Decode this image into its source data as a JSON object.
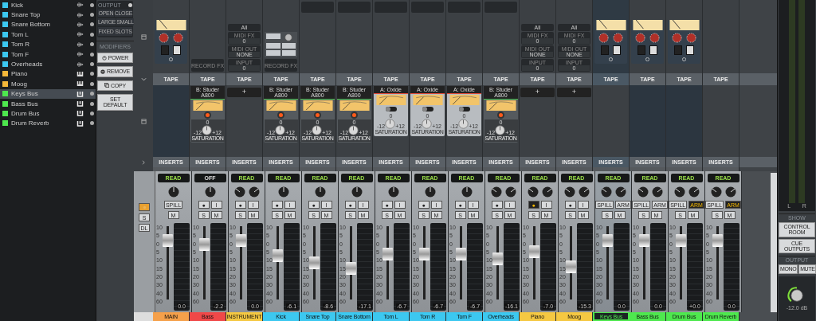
{
  "tracks": [
    {
      "name": "Kick",
      "color": "#3cc8f0",
      "kind": "audio",
      "selected": false
    },
    {
      "name": "Snare Top",
      "color": "#3cc8f0",
      "kind": "audio",
      "selected": false
    },
    {
      "name": "Snare Bottom",
      "color": "#3cc8f0",
      "kind": "audio",
      "selected": false
    },
    {
      "name": "Tom L",
      "color": "#3cc8f0",
      "kind": "audio",
      "selected": false
    },
    {
      "name": "Tom R",
      "color": "#3cc8f0",
      "kind": "audio",
      "selected": false
    },
    {
      "name": "Tom F",
      "color": "#3cc8f0",
      "kind": "audio",
      "selected": false
    },
    {
      "name": "Overheads",
      "color": "#3cc8f0",
      "kind": "audio",
      "selected": false
    },
    {
      "name": "Piano",
      "color": "#f5b83a",
      "kind": "instrument",
      "selected": false
    },
    {
      "name": "Moog",
      "color": "#f5b83a",
      "kind": "instrument",
      "selected": false
    },
    {
      "name": "Keys Bus",
      "color": "#4ee84e",
      "kind": "bus",
      "selected": true
    },
    {
      "name": "Bass Bus",
      "color": "#4ee84e",
      "kind": "bus",
      "selected": false
    },
    {
      "name": "Drum Bus",
      "color": "#4ee84e",
      "kind": "bus",
      "selected": false
    },
    {
      "name": "Drum Reverb",
      "color": "#4ee84e",
      "kind": "bus",
      "selected": false
    }
  ],
  "view_panel": {
    "output": "OUTPUT",
    "open": "OPEN",
    "close": "CLOSE",
    "large": "LARGE",
    "small": "SMALL",
    "fixed_slots": "FIXED SLOTS"
  },
  "modifiers": {
    "title": "MODIFIERS",
    "buttons": [
      "POWER",
      "REMOVE",
      "COPY",
      "SET DEFAULT"
    ]
  },
  "strip_lead": {
    "buttons": [
      "S",
      "DL"
    ]
  },
  "channels": [
    {
      "name": "MAIN",
      "color": "#f5a04a",
      "selected": false,
      "top": {
        "kind": "preamp",
        "switches": [
          {
            "on": false
          },
          {
            "on": true
          }
        ]
      },
      "tape_header": "TAPE",
      "tape": {
        "kind": "none"
      },
      "inserts_header": "INSERTS",
      "automation": {
        "label": "READ",
        "on": true
      },
      "stereo": false,
      "button_rows": [
        [
          {
            "label": "SPILL",
            "active": false
          }
        ],
        [
          {
            "label": "M",
            "active": false
          }
        ]
      ],
      "fader_scale": [
        "10",
        "5",
        "0",
        "5",
        "10",
        "15",
        "20",
        "30",
        "40",
        "60"
      ],
      "level": 0.8,
      "reading": "0.0"
    },
    {
      "name": "Bass",
      "color": "#f04848",
      "selected": false,
      "top": {
        "kind": "record",
        "label": "RECORD FX"
      },
      "tape_header": "TAPE",
      "tape": {
        "kind": "studer",
        "name": "B: Studer A800",
        "lamp_on": true,
        "marks": [
          "0",
          "-12",
          "+12"
        ],
        "label": "SATURATION"
      },
      "inserts_header": "INSERTS",
      "automation": {
        "label": "OFF",
        "on": false
      },
      "stereo": false,
      "button_rows": [
        [
          {
            "label": "●",
            "active": false
          },
          {
            "label": "I",
            "active": false
          }
        ],
        [
          {
            "label": "S",
            "active": false
          },
          {
            "label": "M",
            "active": false
          }
        ]
      ],
      "fader_scale": [
        "10",
        "5",
        "0",
        "5",
        "10",
        "15",
        "20",
        "30",
        "40",
        "60"
      ],
      "level": 0.75,
      "reading": "-2.2"
    },
    {
      "name": "INSTRUMENT",
      "color": "#f5c842",
      "selected": false,
      "top": {
        "kind": "midi",
        "fields": [
          {
            "label": "All"
          },
          {
            "caption": "MIDI FX",
            "label": "0"
          },
          {
            "caption": "MIDI OUT",
            "label": "NONE"
          },
          {
            "caption": "INPUT",
            "label": "0"
          }
        ]
      },
      "tape_header": "TAPE",
      "tape": {
        "kind": "empty",
        "name": "+"
      },
      "inserts_header": "INSERTS",
      "automation": {
        "label": "READ",
        "on": true
      },
      "stereo": true,
      "button_rows": [
        [
          {
            "label": "●",
            "active": false
          },
          {
            "label": "I",
            "active": false
          }
        ],
        [
          {
            "label": "S",
            "active": false
          },
          {
            "label": "M",
            "active": false
          }
        ]
      ],
      "fader_scale": [
        "10",
        "5",
        "0",
        "5",
        "10",
        "15",
        "20",
        "30",
        "40",
        "60"
      ],
      "level": 0.8,
      "reading": "0.0"
    },
    {
      "name": "Kick",
      "color": "#3cc8f0",
      "selected": false,
      "top": {
        "kind": "pads",
        "label": "RECORD FX"
      },
      "tape_header": "TAPE",
      "tape": {
        "kind": "studer",
        "name": "B: Studer A800",
        "lamp_on": true,
        "marks": [
          "0",
          "-12",
          "+12"
        ],
        "label": "SATURATION"
      },
      "inserts_header": "INSERTS",
      "automation": {
        "label": "READ",
        "on": true
      },
      "stereo": false,
      "button_rows": [
        [
          {
            "label": "●",
            "active": false
          },
          {
            "label": "I",
            "active": false
          }
        ],
        [
          {
            "label": "S",
            "active": false
          },
          {
            "label": "M",
            "active": false
          }
        ]
      ],
      "fader_scale": [
        "10",
        "5",
        "0",
        "5",
        "10",
        "15",
        "20",
        "30",
        "40",
        "60"
      ],
      "level": 0.6,
      "reading": "-6.1"
    },
    {
      "name": "Snare Top",
      "color": "#3cc8f0",
      "selected": false,
      "top": {
        "kind": "box"
      },
      "tape_header": "TAPE",
      "tape": {
        "kind": "studer",
        "name": "B: Studer A800",
        "lamp_on": true,
        "marks": [
          "0",
          "-12",
          "+12"
        ],
        "label": "SATURATION"
      },
      "inserts_header": "INSERTS",
      "automation": {
        "label": "READ",
        "on": true
      },
      "stereo": false,
      "button_rows": [
        [
          {
            "label": "●",
            "active": false
          },
          {
            "label": "I",
            "active": false
          }
        ],
        [
          {
            "label": "S",
            "active": false
          },
          {
            "label": "M",
            "active": false
          }
        ]
      ],
      "fader_scale": [
        "10",
        "5",
        "0",
        "5",
        "10",
        "15",
        "20",
        "30",
        "40",
        "60"
      ],
      "level": 0.5,
      "reading": "-8.6"
    },
    {
      "name": "Snare Bottom",
      "color": "#3cc8f0",
      "selected": false,
      "top": {
        "kind": "box"
      },
      "tape_header": "TAPE",
      "tape": {
        "kind": "studer",
        "name": "B: Studer A800",
        "lamp_on": true,
        "marks": [
          "0",
          "-12",
          "+12"
        ],
        "label": "SATURATION"
      },
      "inserts_header": "INSERTS",
      "automation": {
        "label": "READ",
        "on": true
      },
      "stereo": false,
      "button_rows": [
        [
          {
            "label": "●",
            "active": false
          },
          {
            "label": "I",
            "active": false
          }
        ],
        [
          {
            "label": "S",
            "active": false
          },
          {
            "label": "M",
            "active": false
          }
        ]
      ],
      "fader_scale": [
        "10",
        "5",
        "0",
        "5",
        "10",
        "15",
        "20",
        "30",
        "40",
        "60"
      ],
      "level": 0.42,
      "reading": "-17.1"
    },
    {
      "name": "Tom L",
      "color": "#3cc8f0",
      "selected": false,
      "top": {
        "kind": "box"
      },
      "tape_header": "TAPE",
      "tape": {
        "kind": "oxide",
        "name": "A: Oxide",
        "switch_on": false,
        "marks": [
          "0",
          "-12",
          "+12"
        ],
        "label": "SATURATION"
      },
      "inserts_header": "INSERTS",
      "automation": {
        "label": "READ",
        "on": true
      },
      "stereo": false,
      "button_rows": [
        [
          {
            "label": "●",
            "active": false
          },
          {
            "label": "I",
            "active": false
          }
        ],
        [
          {
            "label": "S",
            "active": false
          },
          {
            "label": "M",
            "active": false
          }
        ]
      ],
      "fader_scale": [
        "10",
        "5",
        "0",
        "5",
        "10",
        "15",
        "20",
        "30",
        "40",
        "60"
      ],
      "level": 0.62,
      "reading": "-6.7"
    },
    {
      "name": "Tom R",
      "color": "#3cc8f0",
      "selected": false,
      "top": {
        "kind": "box"
      },
      "tape_header": "TAPE",
      "tape": {
        "kind": "oxide",
        "name": "A: Oxide",
        "switch_on": false,
        "marks": [
          "0",
          "-12",
          "+12"
        ],
        "label": "SATURATION"
      },
      "inserts_header": "INSERTS",
      "automation": {
        "label": "READ",
        "on": true
      },
      "stereo": false,
      "button_rows": [
        [
          {
            "label": "●",
            "active": false
          },
          {
            "label": "I",
            "active": false
          }
        ],
        [
          {
            "label": "S",
            "active": false
          },
          {
            "label": "M",
            "active": false
          }
        ]
      ],
      "fader_scale": [
        "10",
        "5",
        "0",
        "5",
        "10",
        "15",
        "20",
        "30",
        "40",
        "60"
      ],
      "level": 0.62,
      "reading": "-6.7"
    },
    {
      "name": "Tom F",
      "color": "#3cc8f0",
      "selected": false,
      "top": {
        "kind": "box"
      },
      "tape_header": "TAPE",
      "tape": {
        "kind": "oxide",
        "name": "A: Oxide",
        "switch_on": false,
        "marks": [
          "0",
          "-12",
          "+12"
        ],
        "label": "SATURATION"
      },
      "inserts_header": "INSERTS",
      "automation": {
        "label": "READ",
        "on": true
      },
      "stereo": false,
      "button_rows": [
        [
          {
            "label": "●",
            "active": false
          },
          {
            "label": "I",
            "active": false
          }
        ],
        [
          {
            "label": "S",
            "active": false
          },
          {
            "label": "M",
            "active": false
          }
        ]
      ],
      "fader_scale": [
        "10",
        "5",
        "0",
        "5",
        "10",
        "15",
        "20",
        "30",
        "40",
        "60"
      ],
      "level": 0.62,
      "reading": "-6.7"
    },
    {
      "name": "Overheads",
      "color": "#3cc8f0",
      "selected": false,
      "top": {
        "kind": "box"
      },
      "tape_header": "TAPE",
      "tape": {
        "kind": "studer",
        "name": "B: Studer A800",
        "lamp_on": true,
        "marks": [
          "0",
          "-12",
          "+12"
        ],
        "label": "SATURATION"
      },
      "inserts_header": "INSERTS",
      "automation": {
        "label": "READ",
        "on": true
      },
      "stereo": true,
      "button_rows": [
        [
          {
            "label": "●",
            "active": false
          },
          {
            "label": "I",
            "active": false
          }
        ],
        [
          {
            "label": "S",
            "active": false
          },
          {
            "label": "M",
            "active": false
          }
        ]
      ],
      "fader_scale": [
        "10",
        "5",
        "0",
        "5",
        "10",
        "15",
        "20",
        "30",
        "40",
        "60"
      ],
      "level": 0.55,
      "reading": "-16.1"
    },
    {
      "name": "Piano",
      "color": "#f5c842",
      "selected": false,
      "top": {
        "kind": "midi",
        "fields": [
          {
            "label": "All"
          },
          {
            "caption": "MIDI FX",
            "label": "0"
          },
          {
            "caption": "MIDI OUT",
            "label": "NONE"
          },
          {
            "caption": "INPUT",
            "label": "0"
          }
        ]
      },
      "tape_header": "TAPE",
      "tape": {
        "kind": "empty",
        "name": "+"
      },
      "inserts_header": "INSERTS",
      "automation": {
        "label": "READ",
        "on": true
      },
      "stereo": true,
      "button_rows": [
        [
          {
            "label": "●",
            "active": true
          },
          {
            "label": "I",
            "active": false
          }
        ],
        [
          {
            "label": "S",
            "active": false
          },
          {
            "label": "M",
            "active": false
          }
        ]
      ],
      "fader_scale": [
        "10",
        "5",
        "0",
        "5",
        "10",
        "15",
        "20",
        "30",
        "40",
        "60"
      ],
      "level": 0.65,
      "reading": "-7.0"
    },
    {
      "name": "Moog",
      "color": "#f5c842",
      "selected": false,
      "top": {
        "kind": "midi",
        "fields": [
          {
            "label": "All"
          },
          {
            "caption": "MIDI FX",
            "label": "0"
          },
          {
            "caption": "MIDI OUT",
            "label": "NONE"
          },
          {
            "caption": "INPUT",
            "label": "0"
          }
        ]
      },
      "tape_header": "TAPE",
      "tape": {
        "kind": "empty",
        "name": "+"
      },
      "inserts_header": "INSERTS",
      "automation": {
        "label": "READ",
        "on": true
      },
      "stereo": true,
      "button_rows": [
        [
          {
            "label": "●",
            "active": false
          },
          {
            "label": "I",
            "active": false
          }
        ],
        [
          {
            "label": "S",
            "active": false
          },
          {
            "label": "M",
            "active": false
          }
        ]
      ],
      "fader_scale": [
        "10",
        "5",
        "0",
        "5",
        "10",
        "15",
        "20",
        "30",
        "40",
        "60"
      ],
      "level": 0.45,
      "reading": "-15.3"
    },
    {
      "name": "Keys Bus",
      "color": "#4ee84e",
      "selected": true,
      "top": {
        "kind": "preamp",
        "switches": [
          {
            "on": false
          },
          {
            "on": true
          }
        ]
      },
      "tape_header": "TAPE",
      "tape": {
        "kind": "none"
      },
      "inserts_header": "INSERTS",
      "automation": {
        "label": "READ",
        "on": true
      },
      "stereo": true,
      "button_rows": [
        [
          {
            "label": "SPILL",
            "active": false
          },
          {
            "label": "ARM",
            "active": false
          }
        ],
        [
          {
            "label": "S",
            "active": false
          },
          {
            "label": "M",
            "active": false
          }
        ]
      ],
      "fader_scale": [
        "10",
        "5",
        "0",
        "5",
        "10",
        "15",
        "20",
        "30",
        "40",
        "60"
      ],
      "level": 0.8,
      "reading": "0.0"
    },
    {
      "name": "Bass Bus",
      "color": "#4ee84e",
      "selected": false,
      "top": {
        "kind": "preamp",
        "switches": [
          {
            "on": false
          },
          {
            "on": true
          }
        ]
      },
      "tape_header": "TAPE",
      "tape": {
        "kind": "none"
      },
      "inserts_header": "INSERTS",
      "automation": {
        "label": "READ",
        "on": true
      },
      "stereo": true,
      "button_rows": [
        [
          {
            "label": "SPILL",
            "active": false
          },
          {
            "label": "ARM",
            "active": false
          }
        ],
        [
          {
            "label": "S",
            "active": false
          },
          {
            "label": "M",
            "active": false
          }
        ]
      ],
      "fader_scale": [
        "10",
        "5",
        "0",
        "5",
        "10",
        "15",
        "20",
        "30",
        "40",
        "60"
      ],
      "level": 0.8,
      "reading": "0.0"
    },
    {
      "name": "Drum Bus",
      "color": "#4ee84e",
      "selected": false,
      "top": {
        "kind": "preamp",
        "switches": [
          {
            "on": false
          },
          {
            "on": true
          }
        ]
      },
      "tape_header": "TAPE",
      "tape": {
        "kind": "none"
      },
      "inserts_header": "INSERTS",
      "automation": {
        "label": "READ",
        "on": true
      },
      "stereo": true,
      "button_rows": [
        [
          {
            "label": "SPILL",
            "active": false
          },
          {
            "label": "ARM",
            "active": true
          }
        ],
        [
          {
            "label": "S",
            "active": false
          },
          {
            "label": "M",
            "active": false
          }
        ]
      ],
      "fader_scale": [
        "10",
        "5",
        "0",
        "5",
        "10",
        "15",
        "20",
        "30",
        "40",
        "60"
      ],
      "level": 0.8,
      "reading": "+0.0"
    },
    {
      "name": "Drum Reverb",
      "color": "#4ee84e",
      "selected": false,
      "top": {
        "kind": "none"
      },
      "tape_header": "TAPE",
      "tape": {
        "kind": "none"
      },
      "inserts_header": "INSERTS",
      "automation": {
        "label": "READ",
        "on": true
      },
      "stereo": true,
      "button_rows": [
        [
          {
            "label": "SPILL",
            "active": false
          },
          {
            "label": "ARM",
            "active": true
          }
        ],
        [
          {
            "label": "S",
            "active": false
          },
          {
            "label": "M",
            "active": false
          }
        ]
      ],
      "fader_scale": [
        "10",
        "5",
        "0",
        "5",
        "10",
        "15",
        "20",
        "30",
        "40",
        "60"
      ],
      "level": 0.8,
      "reading": "0.0"
    }
  ],
  "monitor": {
    "meter_labels": [
      "L",
      "R"
    ],
    "show_title": "SHOW",
    "show_buttons": [
      "CONTROL ROOM",
      "CUE OUTPUTS"
    ],
    "output_title": "OUTPUT",
    "output_buttons": [
      "MONO",
      "MUTE"
    ],
    "volume_reading": "-12.0 dB"
  }
}
